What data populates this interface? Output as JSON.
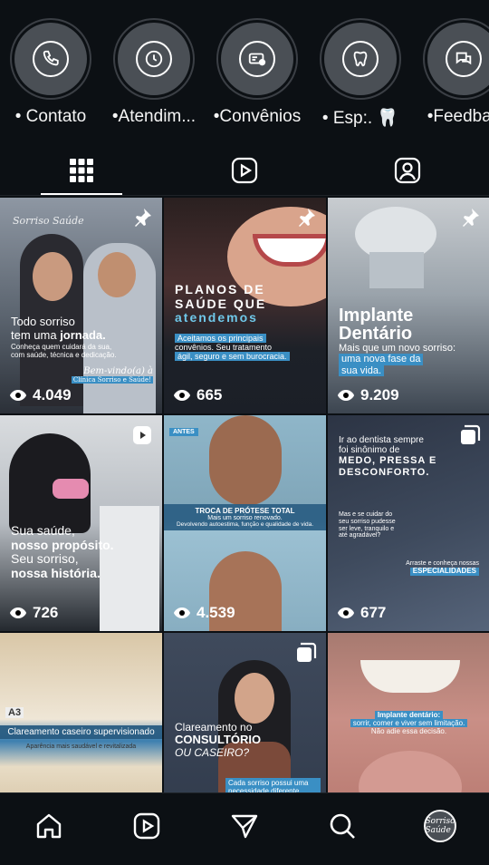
{
  "highlights": [
    {
      "label": "• Contato",
      "icon": "phone-icon"
    },
    {
      "label": "•Atendim...",
      "icon": "clock-icon"
    },
    {
      "label": "•Convênios",
      "icon": "card-icon"
    },
    {
      "label": "• Esp:. 🦷",
      "icon": "tooth-shield-icon"
    },
    {
      "label": "•Feedbac",
      "icon": "chat-icon"
    }
  ],
  "tabs": {
    "active": "grid"
  },
  "posts": [
    {
      "views": "4.049",
      "pinned": true,
      "logo": "Sorriso Saúde",
      "caption_line1": "Todo sorriso",
      "caption_line2a": "tem uma ",
      "caption_line2b": "jornada.",
      "caption_small": "Conheça quem cuidará da sua, com saúde, técnica e dedicação.",
      "welcome": "Bem-vindo(a) à",
      "welcome_clinic": "Clínica Sorriso e Saúde!"
    },
    {
      "views": "665",
      "pinned": true,
      "caption_line1": "PLANOS DE",
      "caption_line2": "SAÚDE QUE",
      "caption_line3": "atendemos",
      "caption_small1": "Aceitamos os principais",
      "caption_small2": "convênios. Seu tratamento",
      "caption_small3": "ágil, seguro e sem burocracia."
    },
    {
      "views": "9.209",
      "pinned": true,
      "caption_line1": "Implante",
      "caption_line2": "Dentário",
      "caption_small1": "Mais que um novo sorriso:",
      "caption_small2": "uma nova fase da",
      "caption_small3": "sua vida."
    },
    {
      "views": "726",
      "reel": true,
      "caption_line1": "Sua saúde,",
      "caption_line2": "nosso propósito.",
      "caption_line3": "Seu sorriso,",
      "caption_line4": "nossa história."
    },
    {
      "views": "4.539",
      "before": "ANTES",
      "bar_title": "TROCA DE PRÓTESE TOTAL",
      "bar_small": "Mais um sorriso renovado.",
      "bar_small2": "Devolvendo autoestima, função e qualidade de vida."
    },
    {
      "views": "677",
      "carousel": true,
      "caption_line1": "Ir ao dentista sempre",
      "caption_line2": "foi sinônimo de",
      "caption_line3": "MEDO, PRESSA E",
      "caption_line4": "DESCONFORTO.",
      "caption_small1": "Mas e se cuidar do",
      "caption_small2": "seu sorriso pudesse",
      "caption_small3": "ser leve, tranquilo e",
      "caption_small4": "até agradável?",
      "caption_small5": "Arraste e conheça nossas",
      "caption_small6": "ESPECIALIDADES"
    },
    {
      "label_a3": "A3",
      "bar_title": "Clareamento caseiro supervisionado",
      "bar_small": "Aparência mais saudável e revitalizada"
    },
    {
      "carousel": true,
      "caption_line1": "Clareamento no",
      "caption_line2": "CONSULTÓRIO",
      "caption_line3": "OU CASEIRO?",
      "caption_small": "Cada sorriso possui uma necessidade diferente"
    },
    {
      "caption_small1": "Implante dentário:",
      "caption_small2": "sorrir, comer e viver sem limitação.",
      "caption_small3": "Não adie essa decisão."
    }
  ],
  "nav": {
    "avatar_text": "Sorriso Saúde"
  }
}
